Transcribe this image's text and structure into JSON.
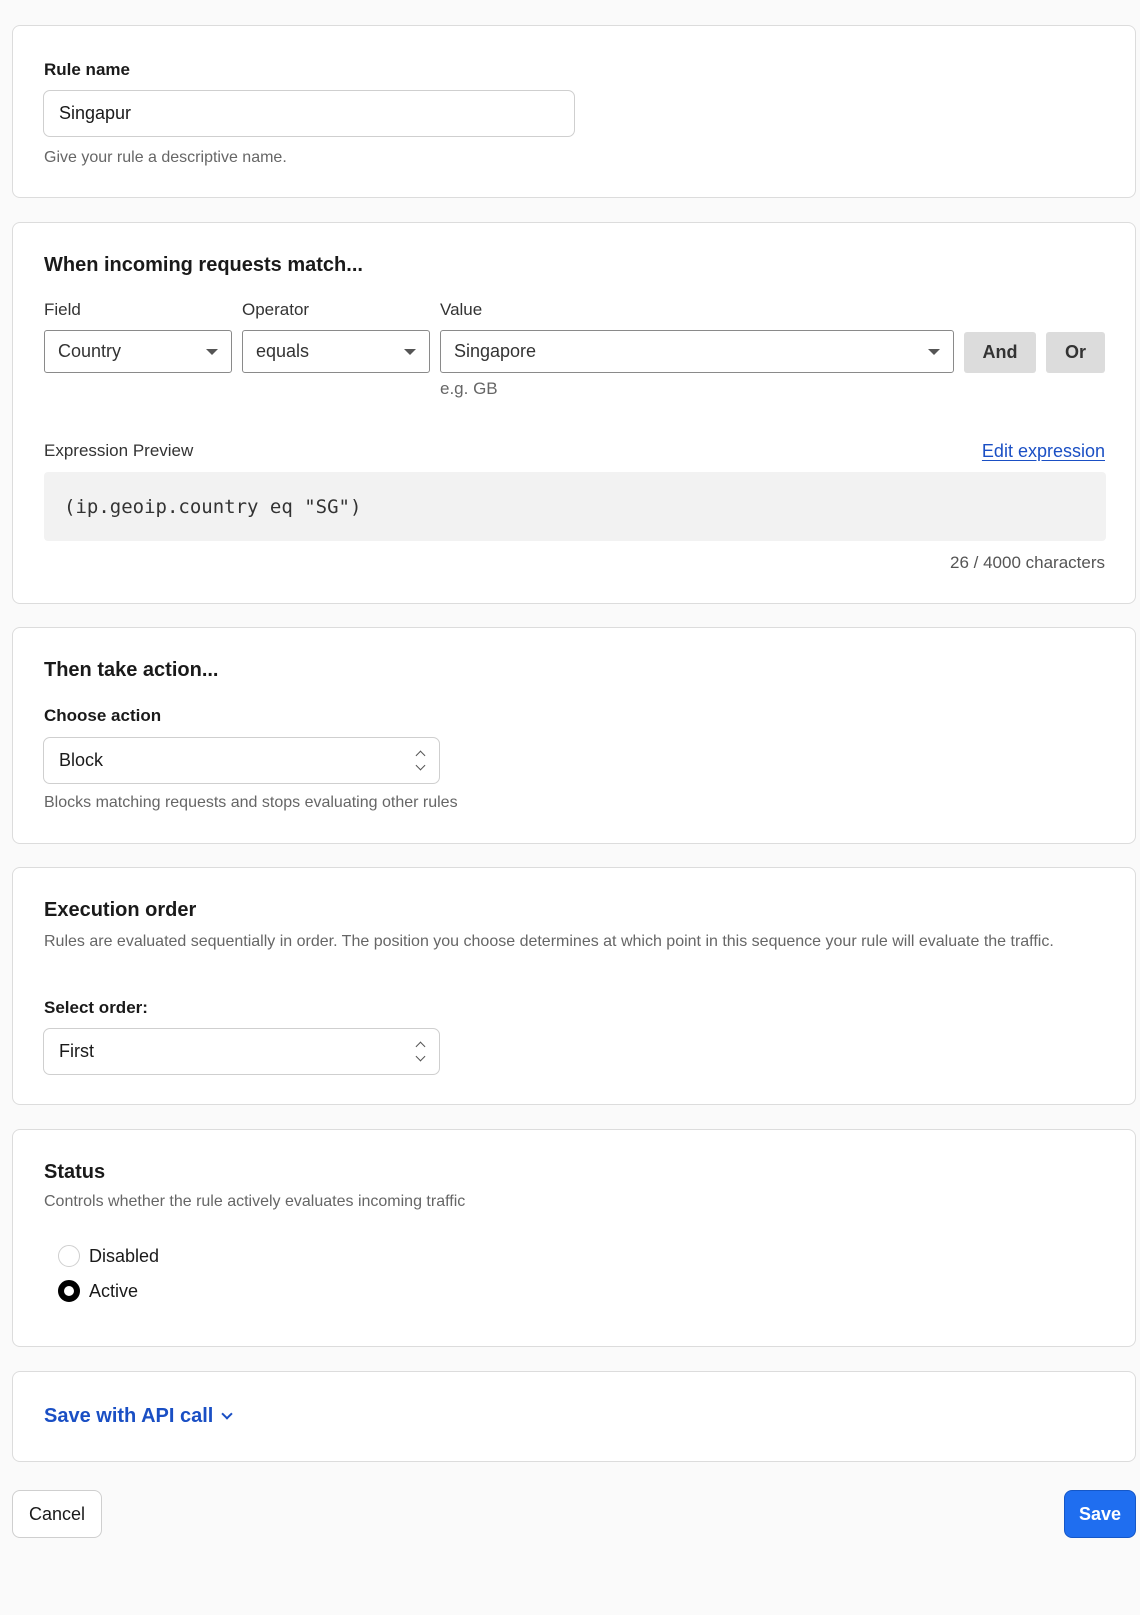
{
  "rule_name": {
    "label": "Rule name",
    "value": "Singapur",
    "help": "Give your rule a descriptive name."
  },
  "match": {
    "heading": "When incoming requests match...",
    "field_label": "Field",
    "operator_label": "Operator",
    "value_label": "Value",
    "field_value": "Country",
    "operator_value": "equals",
    "value_value": "Singapore",
    "value_hint": "e.g. GB",
    "and_label": "And",
    "or_label": "Or",
    "preview_label": "Expression Preview",
    "edit_link": "Edit expression",
    "expression": "(ip.geoip.country eq \"SG\")",
    "char_count": "26 / 4000 characters"
  },
  "action": {
    "heading": "Then take action...",
    "choose_label": "Choose action",
    "selected": "Block",
    "help": "Blocks matching requests and stops evaluating other rules"
  },
  "order": {
    "heading": "Execution order",
    "description": "Rules are evaluated sequentially in order. The position you choose determines at which point in this sequence your rule will evaluate the traffic.",
    "select_label": "Select order:",
    "selected": "First"
  },
  "status": {
    "heading": "Status",
    "description": "Controls whether the rule actively evaluates incoming traffic",
    "options": [
      "Disabled",
      "Active"
    ],
    "selected": "Active"
  },
  "api": {
    "label": "Save with API call"
  },
  "footer": {
    "cancel_label": "Cancel",
    "save_label": "Save"
  },
  "colors": {
    "accent": "#1f6ef0",
    "link": "#1a4fc4"
  }
}
